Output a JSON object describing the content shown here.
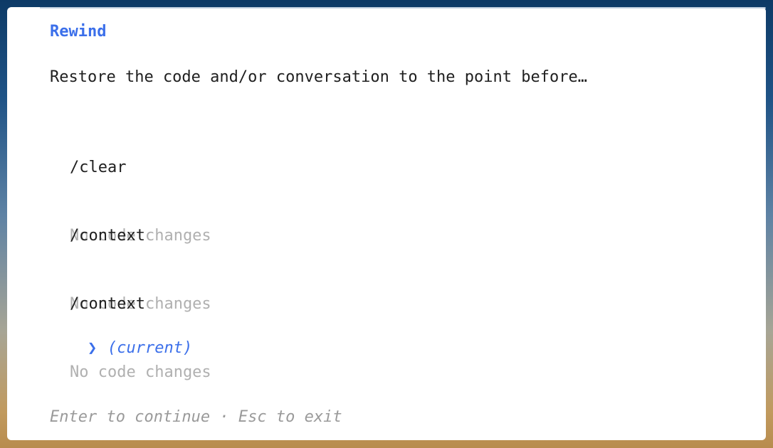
{
  "dialog": {
    "title": "Rewind",
    "prompt": "Restore the code and/or conversation to the point before…",
    "checkpoints": [
      {
        "command": "/clear",
        "detail": "No code changes"
      },
      {
        "command": "/context",
        "detail": "No code changes"
      },
      {
        "command": "/context",
        "detail": "No code changes"
      }
    ],
    "current": {
      "pointer": "❯",
      "label": "(current)"
    },
    "footer": {
      "enter_hint": "Enter to continue",
      "separator": " · ",
      "esc_hint": "Esc to exit"
    }
  },
  "colors": {
    "accent": "#3b6fea",
    "muted": "#b0b0b0",
    "text": "#1f1f1f",
    "footer": "#9a9a9a"
  }
}
